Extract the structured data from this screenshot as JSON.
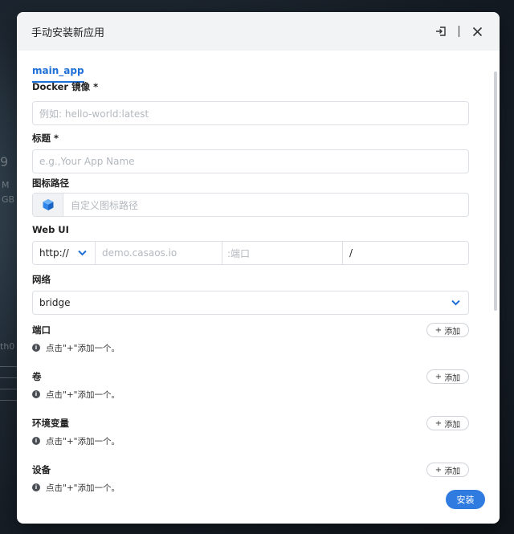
{
  "dialog": {
    "title": "手动安装新应用",
    "tab": "main_app"
  },
  "fields": {
    "docker_image": {
      "label": "Docker 镜像 *",
      "placeholder": "例如: hello-world:latest"
    },
    "title": {
      "label": "标题 *",
      "placeholder": "e.g.,Your App Name"
    },
    "icon_path": {
      "label": "图标路径",
      "placeholder": "自定义图标路径"
    },
    "web_ui": {
      "label": "Web UI",
      "protocol": "http://",
      "host_placeholder": "demo.casaos.io",
      "port_placeholder": ":端口",
      "path": "/"
    },
    "network": {
      "label": "网络",
      "value": "bridge"
    }
  },
  "sections": [
    {
      "label": "端口",
      "add": "添加",
      "hint": "点击\"+\"添加一个。"
    },
    {
      "label": "卷",
      "add": "添加",
      "hint": "点击\"+\"添加一个。"
    },
    {
      "label": "环境变量",
      "add": "添加",
      "hint": "点击\"+\"添加一个。"
    },
    {
      "label": "设备",
      "add": "添加",
      "hint": "点击\"+\"添加一个。"
    }
  ],
  "install_label": "安装",
  "icons": {
    "import": "import-icon",
    "close": "close-icon",
    "chevron": "chevron-down-icon",
    "info": "info-icon",
    "app": "app-cube-icon"
  },
  "colors": {
    "accent": "#2f7be0",
    "tab_accent": "#1e6fd6"
  },
  "background": {
    "fragments": [
      "9",
      "M",
      "GB",
      "th0"
    ]
  }
}
